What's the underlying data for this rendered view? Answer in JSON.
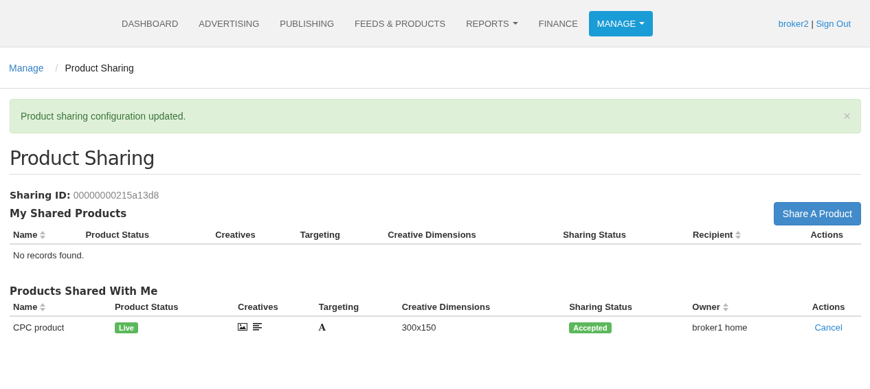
{
  "nav": {
    "items": [
      {
        "label": "DASHBOARD",
        "selected": false,
        "dropdown": false
      },
      {
        "label": "ADVERTISING",
        "selected": false,
        "dropdown": false
      },
      {
        "label": "PUBLISHING",
        "selected": false,
        "dropdown": false
      },
      {
        "label": "FEEDS & PRODUCTS",
        "selected": false,
        "dropdown": false
      },
      {
        "label": "REPORTS",
        "selected": false,
        "dropdown": true
      },
      {
        "label": "FINANCE",
        "selected": false,
        "dropdown": false
      },
      {
        "label": "MANAGE",
        "selected": true,
        "dropdown": true
      }
    ],
    "user": "broker2",
    "separator": "|",
    "sign_out": "Sign Out"
  },
  "breadcrumb": [
    {
      "label": "Manage",
      "link": true
    },
    {
      "label": "Product Sharing",
      "link": false
    }
  ],
  "breadcrumb_separator": "/",
  "alert": {
    "text": "Product sharing configuration updated.",
    "close": "×"
  },
  "page_title": "Product Sharing",
  "sharing_id": {
    "label": "Sharing ID:",
    "value": "00000000215a13d8"
  },
  "my_shared": {
    "title": "My Shared Products",
    "button": "Share A Product",
    "columns": [
      {
        "label": "Name",
        "sortable": true
      },
      {
        "label": "Product Status",
        "sortable": false
      },
      {
        "label": "Creatives",
        "sortable": false
      },
      {
        "label": "Targeting",
        "sortable": false
      },
      {
        "label": "Creative Dimensions",
        "sortable": false
      },
      {
        "label": "Sharing Status",
        "sortable": false
      },
      {
        "label": "Recipient",
        "sortable": true
      },
      {
        "label": "Actions",
        "sortable": false
      }
    ],
    "empty": "No records found."
  },
  "shared_with_me": {
    "title": "Products Shared With Me",
    "columns": [
      {
        "label": "Name",
        "sortable": true
      },
      {
        "label": "Product Status",
        "sortable": false
      },
      {
        "label": "Creatives",
        "sortable": false
      },
      {
        "label": "Targeting",
        "sortable": false
      },
      {
        "label": "Creative Dimensions",
        "sortable": false
      },
      {
        "label": "Sharing Status",
        "sortable": false
      },
      {
        "label": "Owner",
        "sortable": true
      },
      {
        "label": "Actions",
        "sortable": false
      }
    ],
    "rows": [
      [
        {
          "kind": "text",
          "text": "CPC product"
        },
        {
          "kind": "badge",
          "text": "Live"
        },
        {
          "kind": "creatives"
        },
        {
          "kind": "targeting",
          "text": "A"
        },
        {
          "kind": "text",
          "text": "300x150"
        },
        {
          "kind": "badge",
          "text": "Accepted"
        },
        {
          "kind": "text",
          "text": "broker1 home"
        },
        {
          "kind": "link",
          "text": "Cancel"
        }
      ]
    ]
  }
}
